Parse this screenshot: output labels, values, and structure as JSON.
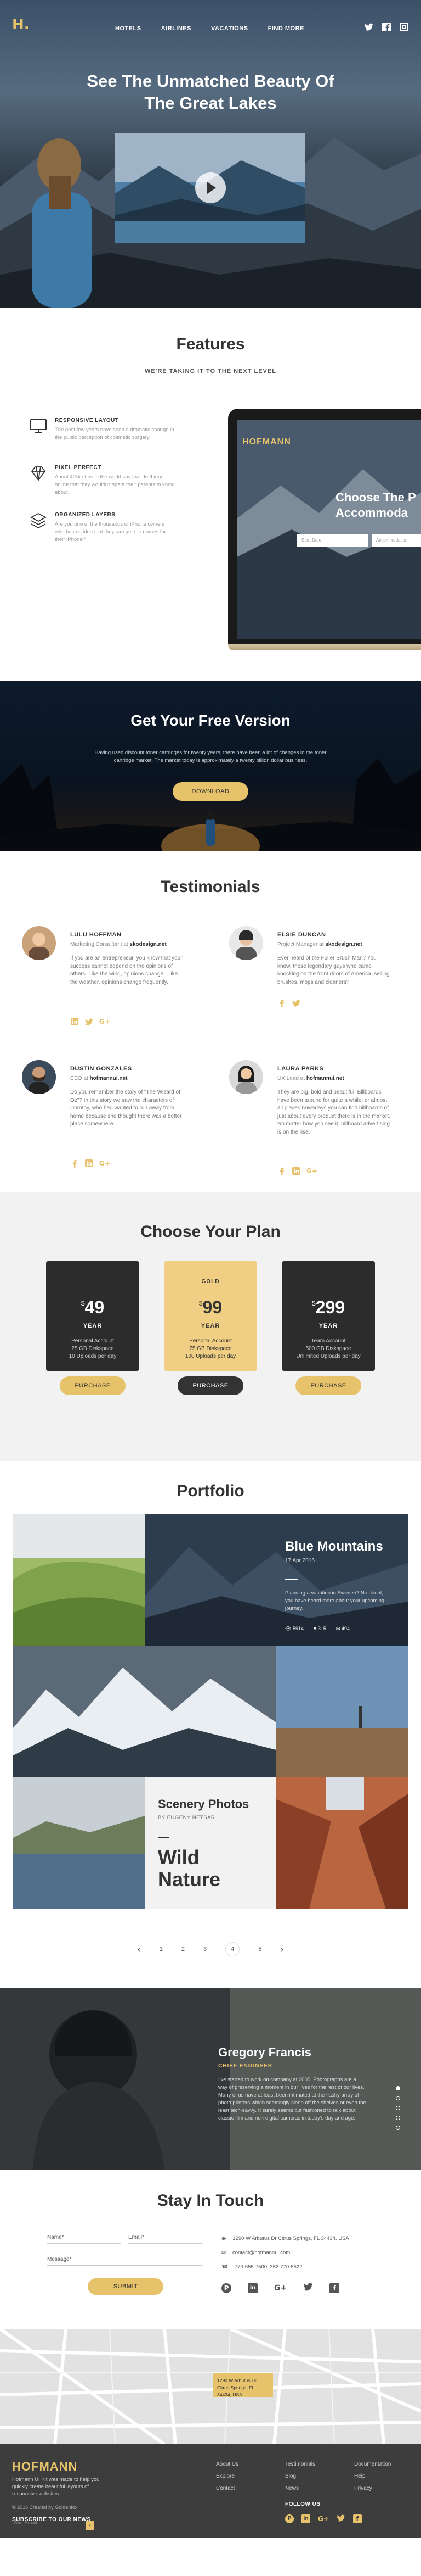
{
  "brand": {
    "logo": "H.",
    "accent": "#e6c26a",
    "name": "HOFMANN"
  },
  "nav": {
    "items": [
      "HOTELS",
      "AIRLINES",
      "VACATIONS",
      "FIND MORE"
    ]
  },
  "hero": {
    "title_1": "See The Unmatched Beauty Of",
    "title_2": "The Great Lakes"
  },
  "features": {
    "title": "Features",
    "subtitle": "WE'RE TAKING IT TO THE NEXT LEVEL",
    "items": [
      {
        "title": "RESPONSIVE LAYOUT",
        "text": "The past few years have seen a dramatic change in the public perception of cosmetic surgery.",
        "icon": "monitor-icon"
      },
      {
        "title": "PIXEL PERFECT",
        "text": "About 40% of us in the world say that do things online that they wouldn't spent their parents to know about.",
        "icon": "diamond-icon"
      },
      {
        "title": "ORGANIZED LAYERS",
        "text": "Are you one of the thousands of iPhone owners who has no idea that they can get the games for their iPhone?",
        "icon": "layers-icon"
      }
    ],
    "screen": {
      "logo": "HOFMANN",
      "title_1": "Choose The P",
      "title_2": "Accommoda",
      "field1": "Start Date",
      "field2": "Accommodation"
    }
  },
  "free": {
    "title": "Get Your Free Version",
    "text_1": "Having used discount toner cartridges for twenty years, there have been a lot of changes in the toner",
    "text_2": "cartridge market. The market today is approximately a twenty billion dollar business.",
    "button": "DOWNLOAD"
  },
  "testimonials": {
    "title": "Testimonials",
    "items": [
      {
        "name": "LULU HOFFMAN",
        "role_pre": "Marketing Consultant at",
        "company": "skodesign.net",
        "text": "If you are an entrepreneur, you know that your success cannot depend on the opinions of others. Like the wind, opinions change... like the weather, opinions change frequently."
      },
      {
        "name": "ELSIE DUNCAN",
        "role_pre": "Project Manager at",
        "company": "skodesign.net",
        "text": "Ever heard of the Fuller Brush Man? You know, those legendary guys who came knocking on the front doors of America, selling brushes, mops and cleaners?"
      },
      {
        "name": "DUSTIN GONZALES",
        "role_pre": "CEO at",
        "company": "hofmannui.net",
        "text": "Do you remember the story of \"The Wizard of Oz\"? In this story we saw the characters of Dorothy, who had wanted to run away from home because she thought there was a better place somewhere."
      },
      {
        "name": "LAURA PARKS",
        "role_pre": "UX Lead at",
        "company": "hofmannui.net",
        "text": "They are big, bold and beautiful. Billboards have been around for quite a while, or almost all places nowadays you can find billboards of just about every product there is in the market. No matter how you see it, billboard advertising is on the rise."
      }
    ]
  },
  "plans": {
    "title": "Choose Your Plan",
    "items": [
      {
        "label": "",
        "currency": "$",
        "price": "49",
        "period": "YEAR",
        "lines": [
          "Personal Account",
          "25 GB Diskspace",
          "10 Uploads per day"
        ],
        "button": "PURCHASE"
      },
      {
        "label": "GOLD",
        "currency": "$",
        "price": "99",
        "period": "YEAR",
        "lines": [
          "Personal Account",
          "75 GB Diskspace",
          "100 Uploads per day"
        ],
        "button": "PURCHASE"
      },
      {
        "label": "",
        "currency": "$",
        "price": "299",
        "period": "YEAR",
        "lines": [
          "Team Account",
          "500 GB Diskspace",
          "Unlimited Uploads per day"
        ],
        "button": "PURCHASE"
      }
    ]
  },
  "portfolio": {
    "title": "Portfolio",
    "feature": {
      "title": "Blue Mountains",
      "date": "17 Apr 2016",
      "text": "Planning a vacation in Sweden? No doubt, you have heard more about your upcoming journey.",
      "views": "5914",
      "likes": "315",
      "comments": "494"
    },
    "card": {
      "title": "Scenery Photos",
      "by": "BY EUGENY NETSAR",
      "big_1": "Wild",
      "big_2": "Nature"
    },
    "pages": [
      "1",
      "2",
      "3",
      "4",
      "5"
    ]
  },
  "person": {
    "name": "Gregory Francis",
    "role": "CHIEF ENGINEER",
    "text": "I've started to work on company at 2005. Photographs are a way of preserving a moment in our lives for the rest of our lives. Many of us have at least been intimated at the flashy array of photo printers which seemingly sleep off the shelves or even the least tech-savvy. It surely seems but fashioned to talk about classic film and non-digital cameras in today's day and age."
  },
  "contact": {
    "title": "Stay In Touch",
    "name_label": "Name*",
    "email_label": "Email*",
    "message_label": "Message*",
    "button": "SUBMIT",
    "address": "1290 W Arbutus Dr Citrus Springs, FL 34434, USA",
    "email": "contact@hofmannui.com",
    "phone": "770-555-7500, 352-770-8522"
  },
  "map": {
    "label_1": "1290 W Arbutus Dr",
    "label_2": "Citrus Springs, FL 34434, USA"
  },
  "footer": {
    "brand": "HOFMANN",
    "desc_1": "Hofmann UI Kit was made to help you",
    "desc_2": "quickly create beautiful layouts of",
    "desc_3": "responsive websites.",
    "copyright": "© 2016 Created by Goldenfox",
    "subscribe": "SUBSCRIBE TO OUR NEWS",
    "email_placeholder": "Your Email",
    "col1": [
      "About Us",
      "Explore",
      "Contact"
    ],
    "col2": [
      "Testimonials",
      "Blog",
      "News"
    ],
    "col3": [
      "Documentation",
      "Help",
      "Privacy"
    ],
    "follow": "FOLLOW US"
  }
}
